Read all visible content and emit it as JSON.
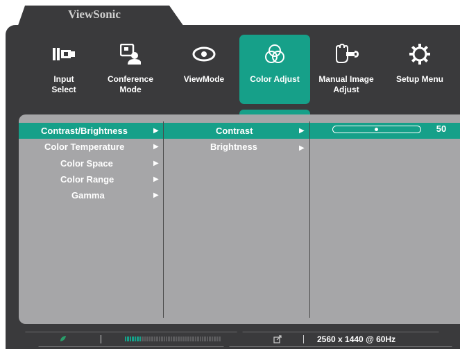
{
  "brand": "ViewSonic",
  "menu": [
    {
      "label": "Input\nSelect",
      "icon": "input-select-icon",
      "active": false
    },
    {
      "label": "Conference\nMode",
      "icon": "conference-mode-icon",
      "active": false
    },
    {
      "label": "ViewMode",
      "icon": "eye-icon",
      "active": false
    },
    {
      "label": "Color Adjust",
      "icon": "color-circles-icon",
      "active": true
    },
    {
      "label": "Manual Image\nAdjust",
      "icon": "hand-wrench-icon",
      "active": false
    },
    {
      "label": "Setup Menu",
      "icon": "gear-icon",
      "active": false
    }
  ],
  "submenu": [
    {
      "label": "Contrast/Brightness",
      "selected": true
    },
    {
      "label": "Color Temperature",
      "selected": false
    },
    {
      "label": "Color Space",
      "selected": false
    },
    {
      "label": "Color Range",
      "selected": false
    },
    {
      "label": "Gamma",
      "selected": false
    }
  ],
  "options": [
    {
      "label": "Contrast",
      "selected": true
    },
    {
      "label": "Brightness",
      "selected": false
    }
  ],
  "slider": {
    "value": "50",
    "fraction": 0.5
  },
  "status": {
    "resolution": "2560 x 1440 @ 60Hz",
    "eco_label": "eco",
    "level_fraction": 0.18
  },
  "colors": {
    "accent": "#16a089",
    "frame": "#3a3a3c",
    "panel": "#a6a6a8"
  }
}
